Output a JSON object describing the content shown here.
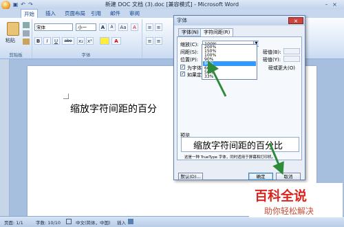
{
  "window": {
    "title": "新建 DOC 文档 (3).doc [兼容模式] - Microsoft Word"
  },
  "ribbon_tabs": [
    "开始",
    "插入",
    "页面布局",
    "引用",
    "邮件",
    "审阅"
  ],
  "ribbon": {
    "paste_label": "粘贴",
    "font_name": "宋体",
    "font_size": "小一",
    "clipboard_group": "剪贴板",
    "font_group": "字体",
    "bold": "B",
    "italic": "I",
    "underline": "U",
    "strike": "abe",
    "grow": "A",
    "shrink": "A",
    "format_a": "Aa",
    "clear": "A"
  },
  "document": {
    "text": "缩放字符间距的百分"
  },
  "dialog": {
    "title": "字体",
    "close": "×",
    "tabs": [
      "字体(N)",
      "字符间距(R)"
    ],
    "scale_label": "缩放(C):",
    "scale_value": "100%",
    "spacing_label": "间距(S):",
    "position_label": "位置(P):",
    "by_label1": "磅值(B):",
    "by_label2": "磅值(Y):",
    "kerning_label": "为字体",
    "kerning_suffix": "磅或更大(O)",
    "grid_label": "如果定",
    "preview_label": "预览",
    "preview_text": "缩放字符间距的百分比",
    "preview_note": "这是一种 TrueType 字体，同时适用于屏幕和打印机。",
    "btn_default": "默认(D)...",
    "btn_ok": "确定",
    "btn_cancel": "取消"
  },
  "dropdown_options": [
    "200%",
    "150%",
    "100%",
    "90%",
    "80%",
    "66%",
    "50%",
    "33%"
  ],
  "dropdown_highlight": "80%",
  "status": {
    "page": "页面: 1/1",
    "words": "字数: 10/10",
    "language": "中文(简体，中国)",
    "insert": "插入"
  },
  "watermark": {
    "line1": "百科全说",
    "line2": "助你轻松解决"
  },
  "colors": {
    "highlight": "#3399ff",
    "arrow": "#2e8b3a",
    "watermark": "#d9251d"
  }
}
